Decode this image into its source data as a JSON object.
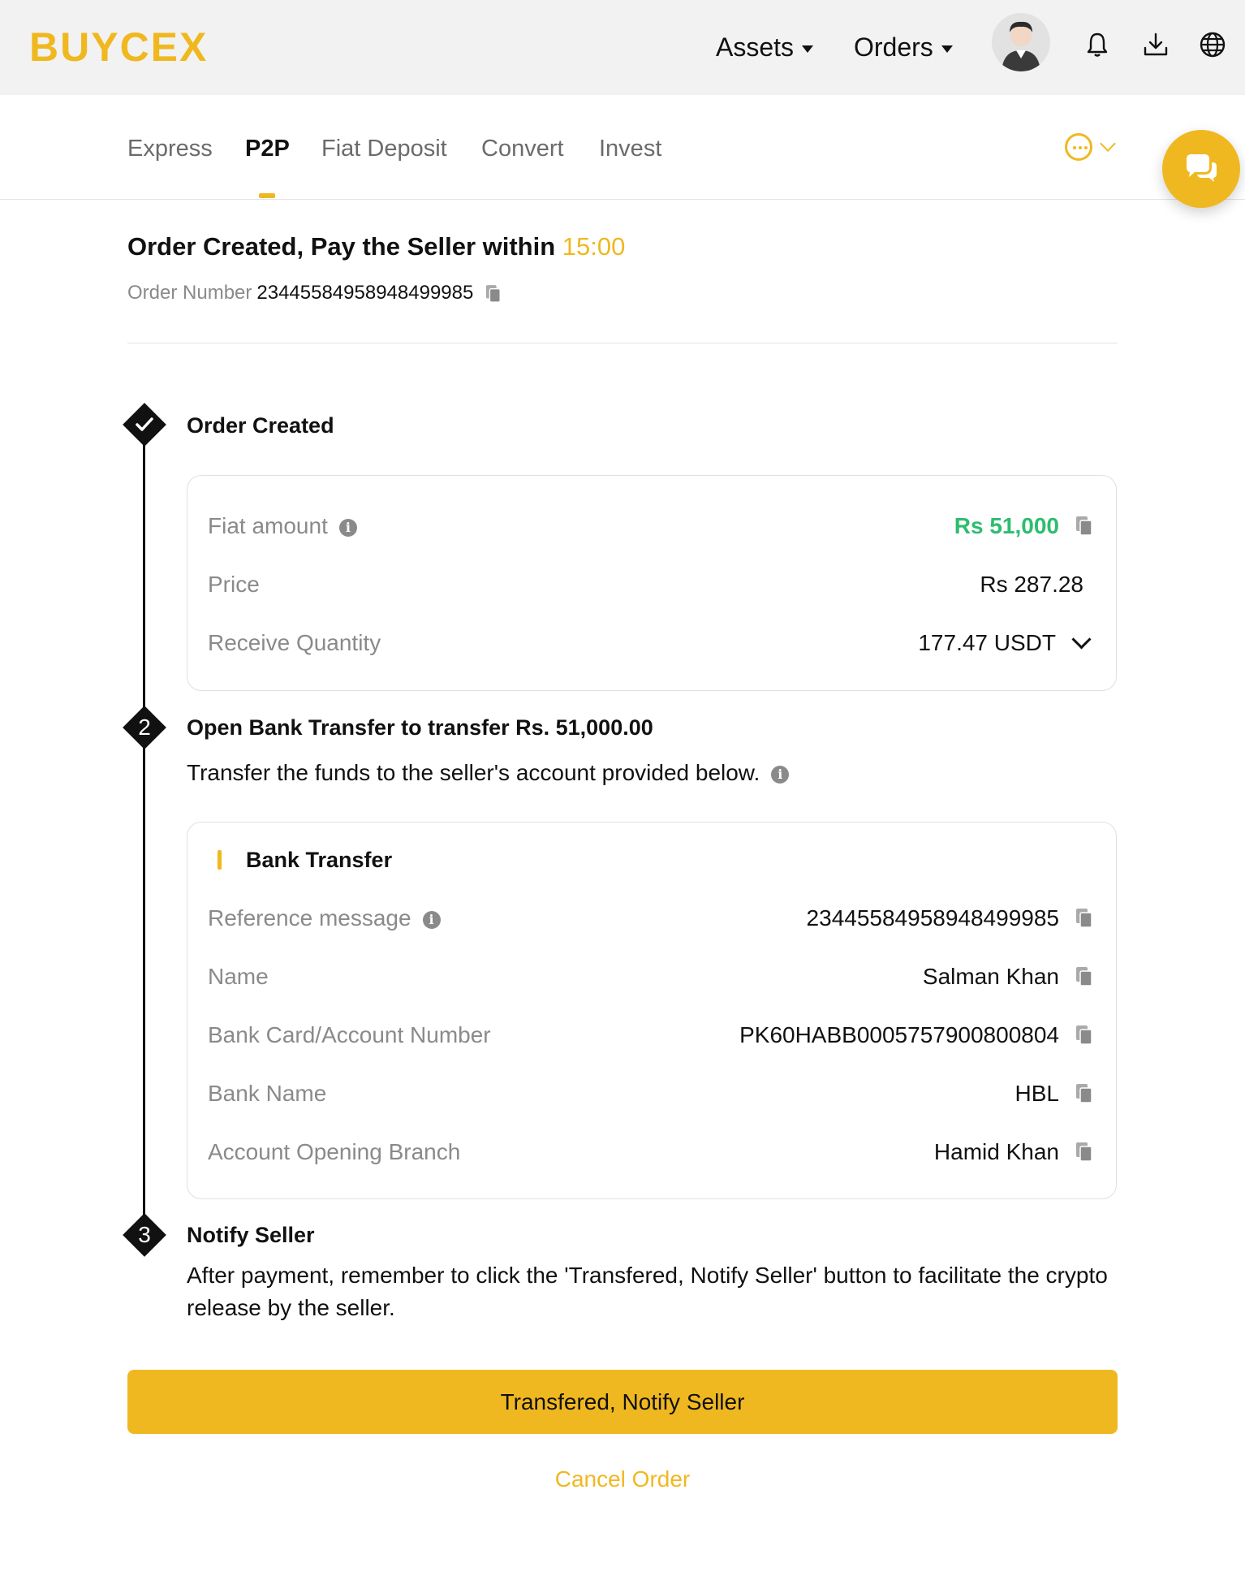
{
  "header": {
    "logo": "BUYCEX",
    "menu": [
      {
        "label": "Assets"
      },
      {
        "label": "Orders"
      }
    ]
  },
  "tabs": [
    {
      "label": "Express",
      "active": false
    },
    {
      "label": "P2P",
      "active": true
    },
    {
      "label": "Fiat Deposit",
      "active": false
    },
    {
      "label": "Convert",
      "active": false
    },
    {
      "label": "Invest",
      "active": false
    }
  ],
  "order": {
    "title": "Order Created, Pay the Seller within",
    "timer": "15:00",
    "number_label": "Order Number",
    "number": "23445584958948499985"
  },
  "step1": {
    "title": "Order Created",
    "rows": {
      "fiat_amount": {
        "label": "Fiat amount",
        "value": "Rs 51,000"
      },
      "price": {
        "label": "Price",
        "value": "Rs 287.28"
      },
      "receive_quantity": {
        "label": "Receive Quantity",
        "value": "177.47 USDT"
      }
    }
  },
  "step2": {
    "number": "2",
    "title": "Open Bank Transfer to transfer Rs. 51,000.00",
    "description": "Transfer the funds to the seller's account provided below.",
    "bank": {
      "title": "Bank Transfer",
      "rows": {
        "reference": {
          "label": "Reference message",
          "value": "23445584958948499985"
        },
        "name": {
          "label": "Name",
          "value": "Salman Khan"
        },
        "account": {
          "label": "Bank Card/Account Number",
          "value": "PK60HABB0005757900800804"
        },
        "bank_name": {
          "label": "Bank Name",
          "value": "HBL"
        },
        "branch": {
          "label": "Account Opening Branch",
          "value": "Hamid Khan"
        }
      }
    }
  },
  "step3": {
    "number": "3",
    "title": "Notify Seller",
    "description": "After payment, remember to click the 'Transfered, Notify Seller' button to facilitate the crypto release by the seller."
  },
  "actions": {
    "primary": "Transfered, Notify Seller",
    "cancel": "Cancel Order"
  },
  "colors": {
    "brand": "#f0b820",
    "positive": "#2dbd6e"
  },
  "icons": [
    "bell-icon",
    "download-icon",
    "globe-icon",
    "copy-icon",
    "info-icon",
    "chat-icon",
    "more-icon",
    "check-icon"
  ]
}
